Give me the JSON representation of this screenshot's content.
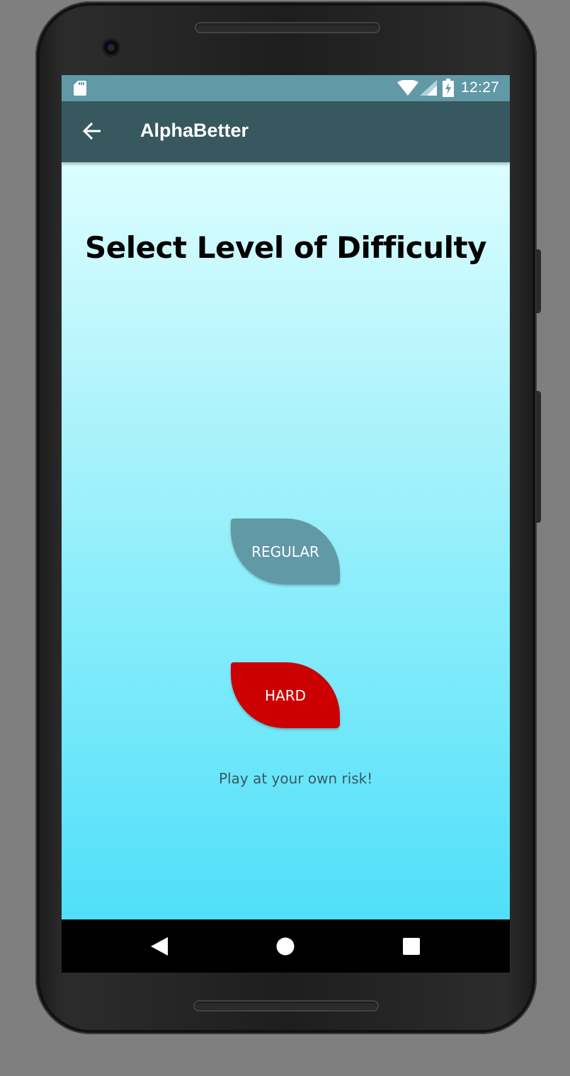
{
  "status_bar": {
    "time": "12:27",
    "icons": [
      "sd-card-icon",
      "wifi-icon",
      "signal-icon",
      "battery-charging-icon"
    ]
  },
  "app_bar": {
    "back_icon": "arrow-left-icon",
    "title": "AlphaBetter"
  },
  "main": {
    "heading": "Select Level of Difficulty",
    "buttons": [
      {
        "label": "REGULAR",
        "color": "#6199a6"
      },
      {
        "label": "HARD",
        "color": "#cc0000"
      }
    ],
    "note": "Play at your own risk!"
  },
  "nav_bar": {
    "icons": [
      "nav-back-icon",
      "nav-home-icon",
      "nav-recents-icon"
    ]
  },
  "colors": {
    "status_bar": "#6199a6",
    "app_bar": "#37585f",
    "gradient_top": "#dcfeff",
    "gradient_bottom": "#4fdff9"
  }
}
